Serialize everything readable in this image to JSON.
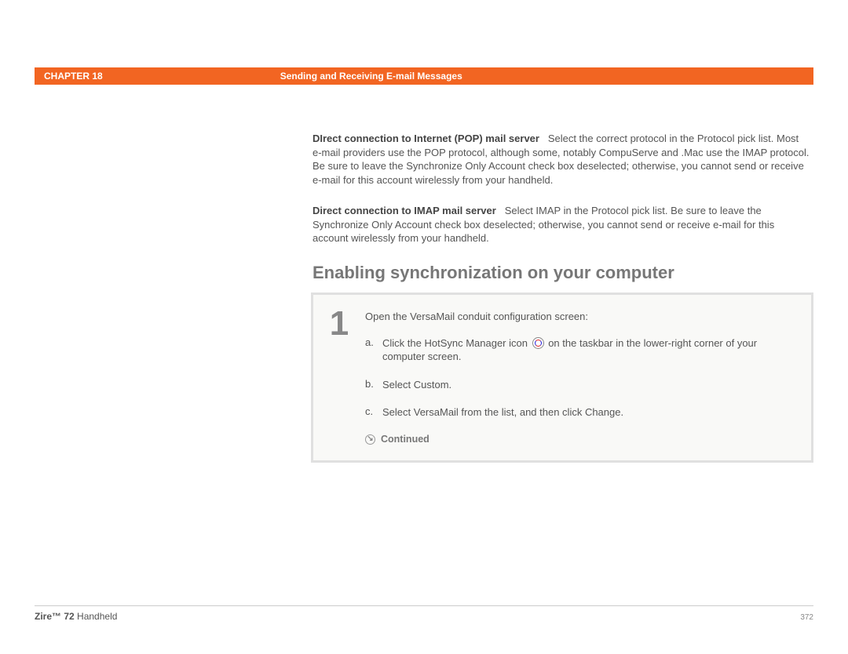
{
  "header": {
    "chapter_label": "CHAPTER 18",
    "chapter_title": "Sending and Receiving E-mail Messages"
  },
  "body": {
    "para1_lead": "DIrect connection to Internet (POP) mail server",
    "para1_rest": "Select the correct protocol in the Protocol pick list. Most e-mail providers use the POP protocol, although some, notably CompuServe and .Mac use the IMAP protocol. Be sure to leave the Synchronize Only Account check box deselected; otherwise, you cannot send or receive e-mail for this account wirelessly from your handheld.",
    "para2_lead": "Direct connection to IMAP mail server",
    "para2_rest": "Select IMAP in the Protocol pick list. Be sure to leave the Synchronize Only Account check box deselected; otherwise, you cannot send or receive e-mail for this account wirelessly from your handheld.",
    "section_title": "Enabling synchronization on your computer"
  },
  "step": {
    "number": "1",
    "lead": "Open the VersaMail conduit configuration screen:",
    "items": [
      {
        "marker": "a.",
        "pre": "Click the HotSync Manager icon ",
        "post": " on the taskbar in the lower-right corner of your computer screen."
      },
      {
        "marker": "b.",
        "pre": "Select Custom.",
        "post": ""
      },
      {
        "marker": "c.",
        "pre": "Select VersaMail from the list, and then click Change.",
        "post": ""
      }
    ],
    "continued": "Continued"
  },
  "footer": {
    "product_bold": "Zire™ 72",
    "product_rest": " Handheld",
    "page": "372"
  }
}
